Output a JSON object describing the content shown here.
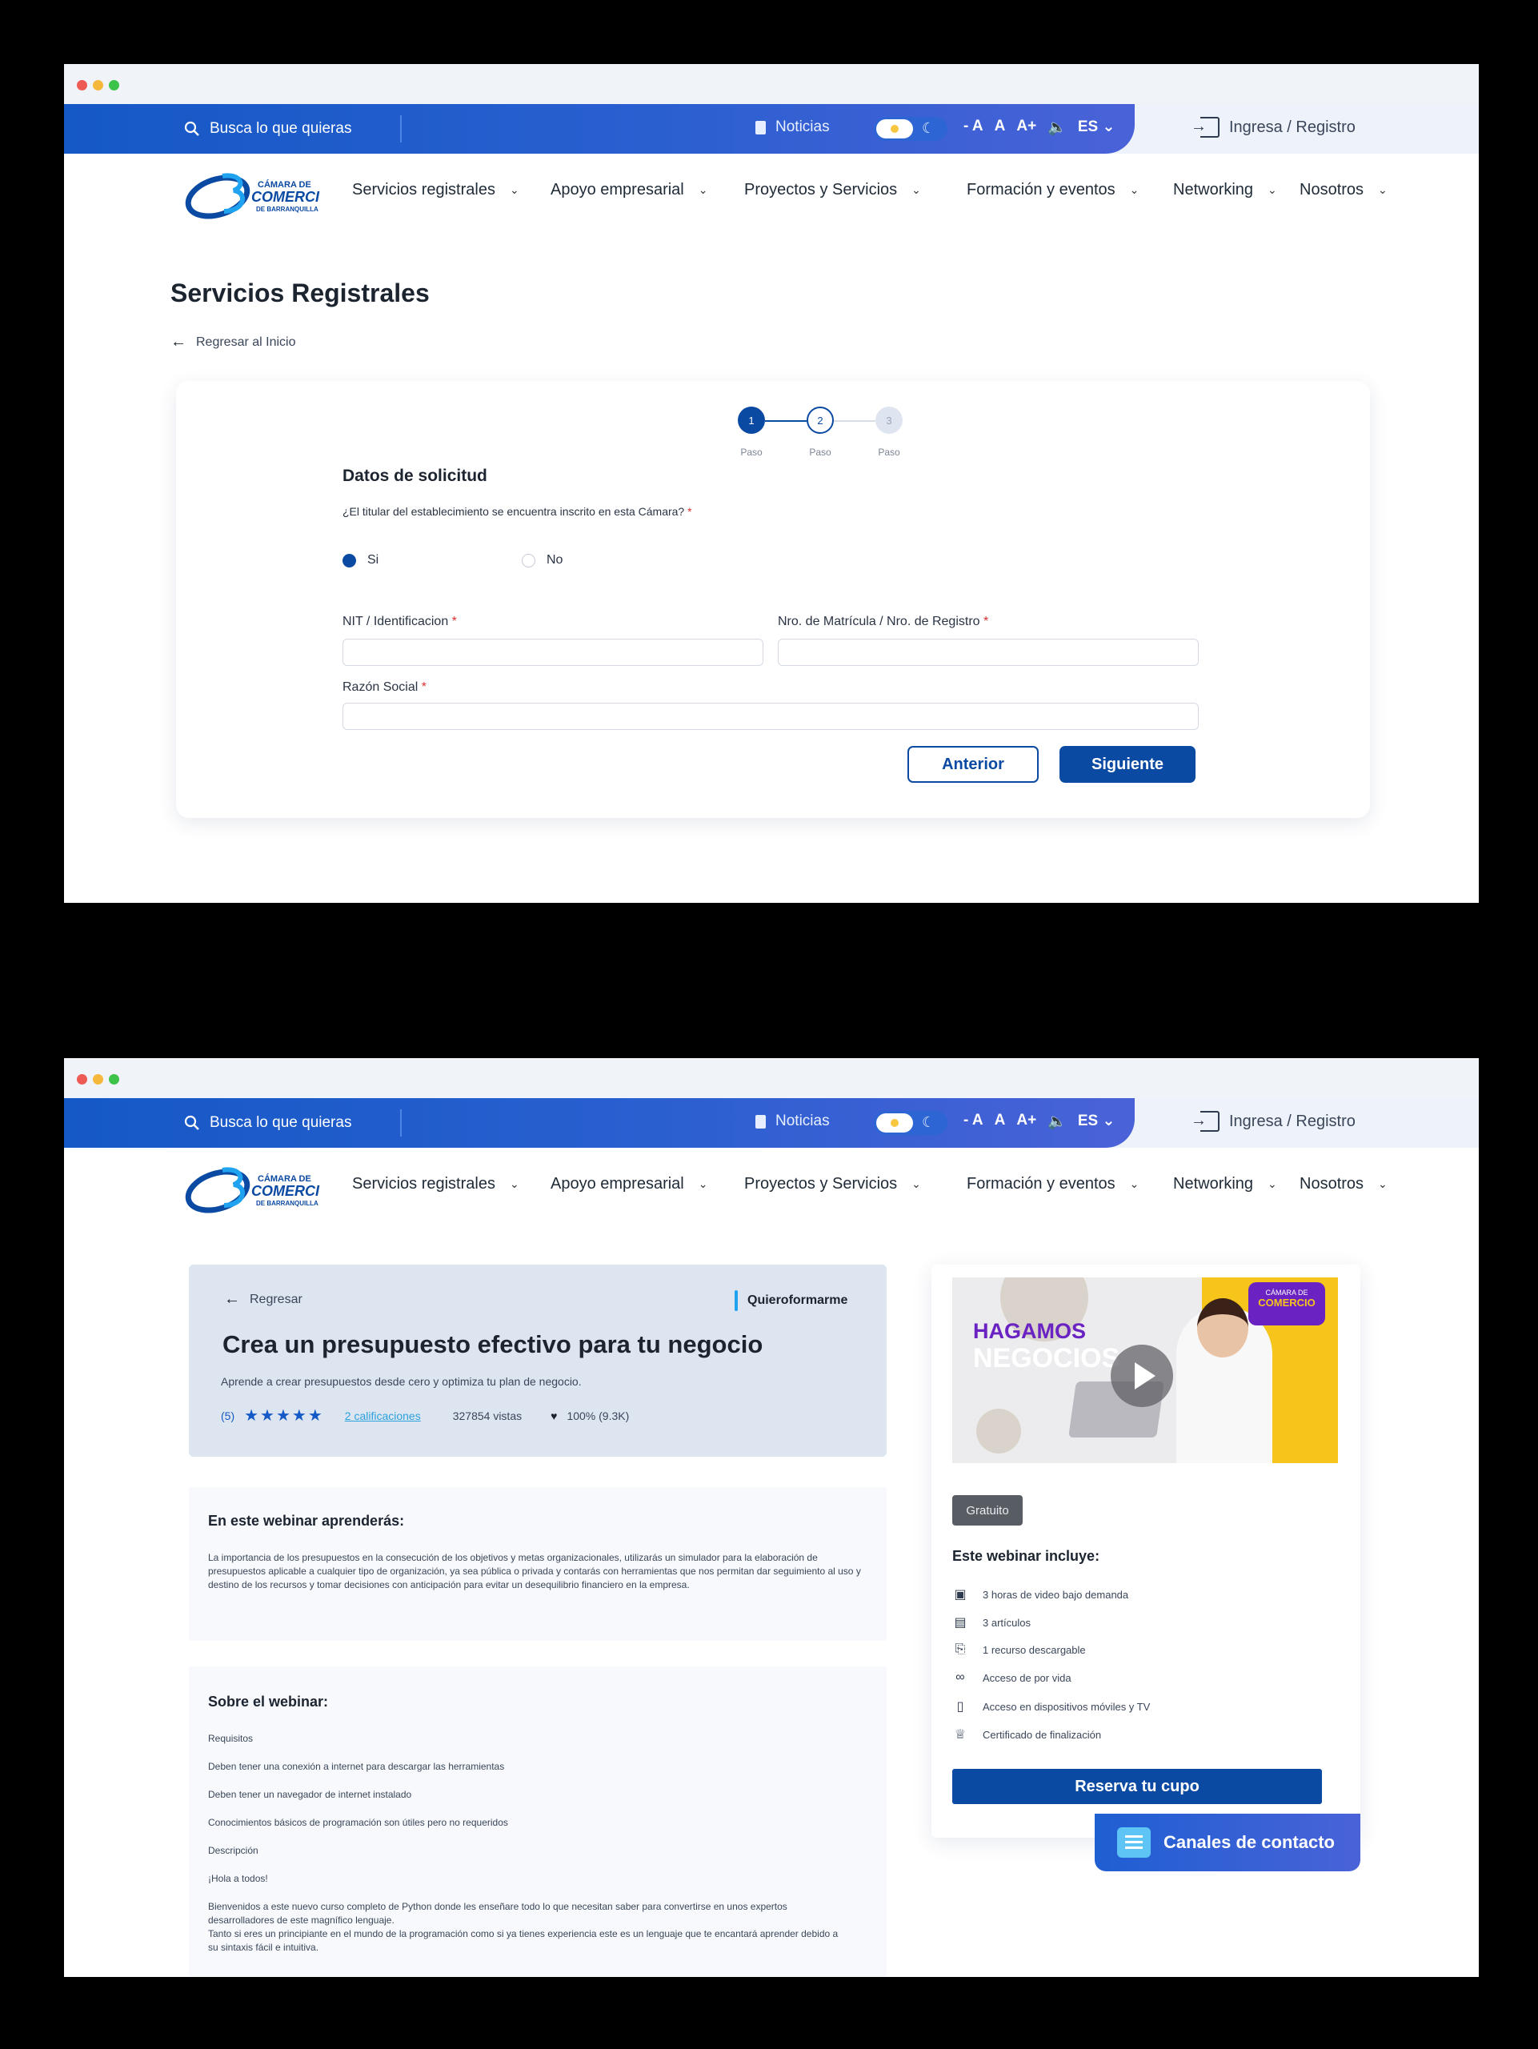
{
  "header": {
    "search_placeholder": "Busca lo que quieras",
    "noticias": "Noticias",
    "font_controls": [
      "- A",
      "A",
      "A+"
    ],
    "language": "ES",
    "login": "Ingresa / Registro",
    "logo_line1": "CÁMARA DE",
    "logo_line2": "COMERCIO",
    "logo_line3": "DE BARRANQUILLA",
    "nav": [
      "Servicios registrales",
      "Apoyo empresarial",
      "Proyectos y Servicios",
      "Formación y eventos",
      "Networking",
      "Nosotros"
    ]
  },
  "form_page": {
    "title": "Servicios Registrales",
    "back": "Regresar al Inicio",
    "steps": [
      {
        "number": "1",
        "label": "Paso",
        "state": "active"
      },
      {
        "number": "2",
        "label": "Paso",
        "state": "current"
      },
      {
        "number": "3",
        "label": "Paso",
        "state": "pending"
      }
    ],
    "form_title": "Datos de solicitud",
    "question": "¿El titular del establecimiento se encuentra inscrito en esta Cámara?",
    "required_mark": "*",
    "options": [
      {
        "label": "Si",
        "selected": true
      },
      {
        "label": "No",
        "selected": false
      }
    ],
    "fields": {
      "nit_label": "NIT / Identificacion",
      "nit_value": "",
      "matricula_label": "Nro. de Matrícula / Nro. de Registro",
      "matricula_value": "",
      "razon_label": "Razón Social",
      "razon_value": ""
    },
    "btn_previous": "Anterior",
    "btn_next": "Siguiente"
  },
  "course_page": {
    "back": "Regresar",
    "tag": "Quieroformarme",
    "title": "Crea un presupuesto efectivo para tu negocio",
    "subtitle": "Aprende a crear presupuestos desde cero y optimiza tu plan de negocio.",
    "rating_count": "(5)",
    "stars": 5,
    "ratings_link": "2 calificaciones",
    "views": "327854 vistas",
    "likes": "100% (9.3K)",
    "learn_title": "En este webinar aprenderás:",
    "learn_body": "La importancia de los presupuestos en la consecución de los objetivos y metas organizacionales, utilizarás un simulador para la elaboración de presupuestos aplicable a cualquier tipo de organización, ya sea pública o privada y contarás con herramientas que nos permitan dar seguimiento al uso y destino de los recursos y tomar decisiones con anticipación para evitar un desequilibrio financiero en la empresa.",
    "about_title": "Sobre el webinar:",
    "about_lines": [
      "Requisitos",
      "Deben tener una conexión a internet para descargar las herramientas",
      "Deben tener un navegador de internet instalado",
      "Conocimientos básicos de programación son útiles pero no requeridos",
      "Descripción",
      "¡Hola a todos!",
      "Bienvenidos a este nuevo curso completo de Python donde les enseñare todo lo que necesitan saber para convertirse en unos expertos desarrolladores de este magnífico lenguaje.",
      "Tanto si eres un principiante en el mundo de la programación como si ya tienes experiencia este es un lenguaje que te encantará aprender debido a su sintaxis fácil e intuitiva."
    ],
    "video": {
      "headline1": "HAGAMOS",
      "headline2": "NEGOCIOS",
      "badge_small": "CÁMARA DE",
      "badge_big": "COMERCIO"
    },
    "price_badge": "Gratuito",
    "includes_title": "Este webinar incluye:",
    "includes": [
      {
        "icon": "video-icon",
        "text": "3 horas de video bajo demanda"
      },
      {
        "icon": "article-icon",
        "text": "3 artículos"
      },
      {
        "icon": "download-icon",
        "text": "1 recurso descargable"
      },
      {
        "icon": "infinity-icon",
        "text": "Acceso de por vida"
      },
      {
        "icon": "mobile-icon",
        "text": "Acceso en dispositivos móviles y TV"
      },
      {
        "icon": "certificate-icon",
        "text": "Certificado de finalización"
      }
    ],
    "reserve": "Reserva tu cupo",
    "contact": "Canales de contacto"
  },
  "colors": {
    "primary": "#0b4aa2",
    "topbar": "#1559c6",
    "accent": "#2aa2dd",
    "badge_purple": "#6a23c2",
    "badge_yellow": "#f6c41a"
  }
}
